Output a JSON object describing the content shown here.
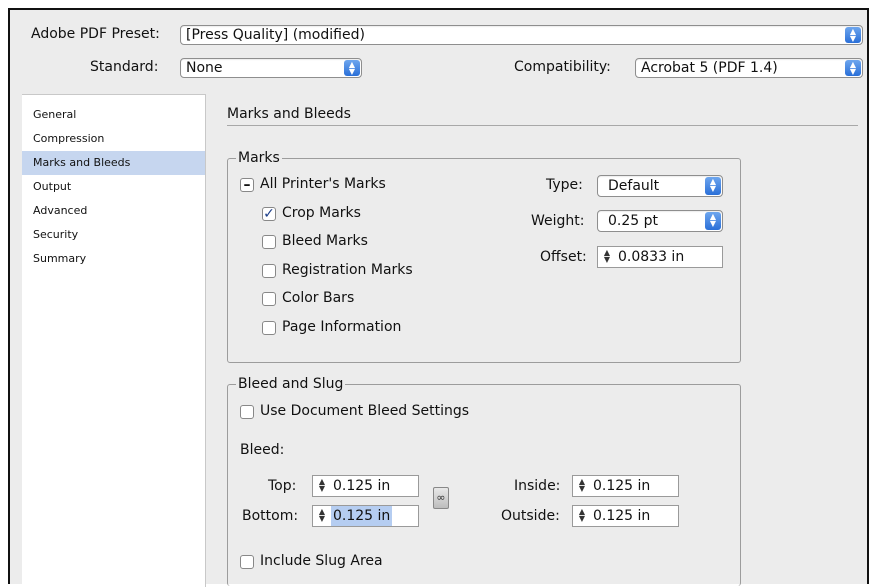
{
  "top": {
    "preset_label": "Adobe PDF Preset:",
    "preset_value": "[Press Quality] (modified)",
    "standard_label": "Standard:",
    "standard_value": "None",
    "compat_label": "Compatibility:",
    "compat_value": "Acrobat 5 (PDF 1.4)"
  },
  "sidebar": {
    "items": [
      {
        "label": "General"
      },
      {
        "label": "Compression"
      },
      {
        "label": "Marks and Bleeds"
      },
      {
        "label": "Output"
      },
      {
        "label": "Advanced"
      },
      {
        "label": "Security"
      },
      {
        "label": "Summary"
      }
    ],
    "selected": "Marks and Bleeds"
  },
  "panel": {
    "title": "Marks and Bleeds"
  },
  "marks": {
    "group_label": "Marks",
    "all_printers": {
      "label": "All Printer's Marks",
      "state": "mixed"
    },
    "crop": {
      "label": "Crop Marks",
      "checked": true
    },
    "bleed": {
      "label": "Bleed Marks",
      "checked": false
    },
    "registration": {
      "label": "Registration Marks",
      "checked": false
    },
    "colorbars": {
      "label": "Color Bars",
      "checked": false
    },
    "pageinfo": {
      "label": "Page Information",
      "checked": false
    },
    "type_label": "Type:",
    "type_value": "Default",
    "weight_label": "Weight:",
    "weight_value": "0.25 pt",
    "offset_label": "Offset:",
    "offset_value": "0.0833 in"
  },
  "bleed_slug": {
    "group_label": "Bleed and Slug",
    "use_doc": {
      "label": "Use Document Bleed Settings",
      "checked": false
    },
    "bleed_label": "Bleed:",
    "top_label": "Top:",
    "top_value": "0.125 in",
    "bottom_label": "Bottom:",
    "bottom_value": "0.125 in",
    "inside_label": "Inside:",
    "inside_value": "0.125 in",
    "outside_label": "Outside:",
    "outside_value": "0.125 in",
    "slug": {
      "label": "Include Slug Area",
      "checked": false
    }
  },
  "icons": {
    "popup_arrows": "updown-arrows-icon",
    "spinner": "stepper-arrows-icon",
    "link": "chain-link-icon"
  },
  "colors": {
    "selection": "#c6d6ef",
    "popup_button": "#2a6fd8",
    "highlight": "#b5cdf1"
  }
}
